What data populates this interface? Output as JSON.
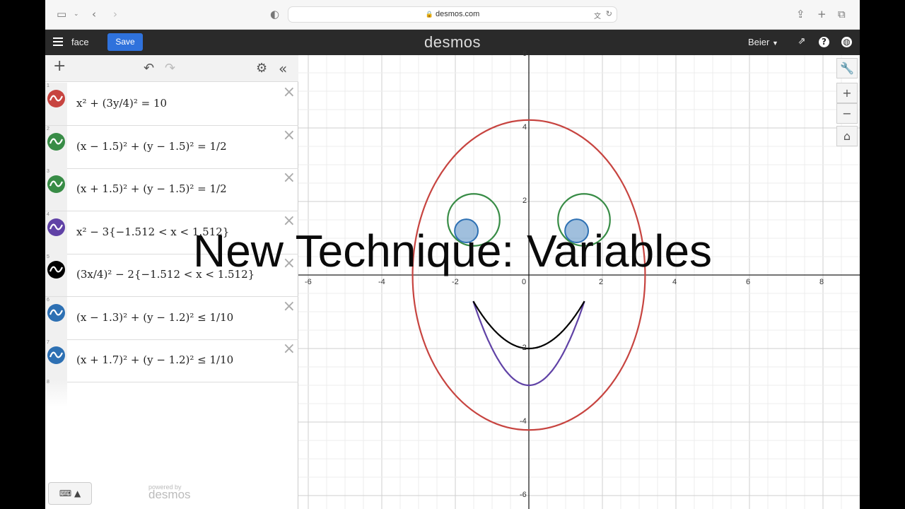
{
  "browser": {
    "url": "desmos.com",
    "icons": [
      "sidebar-icon",
      "chevron-down-icon",
      "back-icon",
      "forward-icon",
      "privacy-shield-icon",
      "lock-icon",
      "translate-icon",
      "reload-icon",
      "share-icon",
      "new-tab-icon",
      "tabs-icon"
    ]
  },
  "header": {
    "title": "face",
    "save_label": "Save",
    "logo": "desmos",
    "user": "Beier"
  },
  "expressions": [
    {
      "index": "1",
      "color": "#c74440",
      "latex": "x² + (3y/4)² = 10"
    },
    {
      "index": "2",
      "color": "#388c46",
      "latex": "(x − 1.5)² + (y − 1.5)² = 1/2"
    },
    {
      "index": "3",
      "color": "#388c46",
      "latex": "(x + 1.5)² + (y − 1.5)² = 1/2"
    },
    {
      "index": "4",
      "color": "#6042a6",
      "latex": "x² − 3{−1.512 < x < 1.512}"
    },
    {
      "index": "5",
      "color": "#000000",
      "latex": "(3x/4)² − 2{−1.512 < x < 1.512}"
    },
    {
      "index": "6",
      "color": "#2d70b3",
      "latex": "(x − 1.3)² + (y − 1.2)² ≤ 1/10"
    },
    {
      "index": "7",
      "color": "#2d70b3",
      "latex": "(x + 1.7)² + (y − 1.2)² ≤ 1/10"
    }
  ],
  "empty_expression_index": "8",
  "footer": {
    "keyboard": "⌨ ▲",
    "powered_by": "powered by",
    "logo": "desmos"
  },
  "graph": {
    "x_ticks": [
      "-6",
      "-4",
      "-2",
      "0",
      "2",
      "4",
      "6",
      "8"
    ],
    "y_ticks": [
      "6",
      "4",
      "2",
      "-2",
      "-4",
      "-6"
    ],
    "tools": {
      "wrench": "🔧",
      "zoom_in": "+",
      "zoom_out": "−",
      "home": "⌂"
    }
  },
  "overlay_text": "New Technique: Variables"
}
